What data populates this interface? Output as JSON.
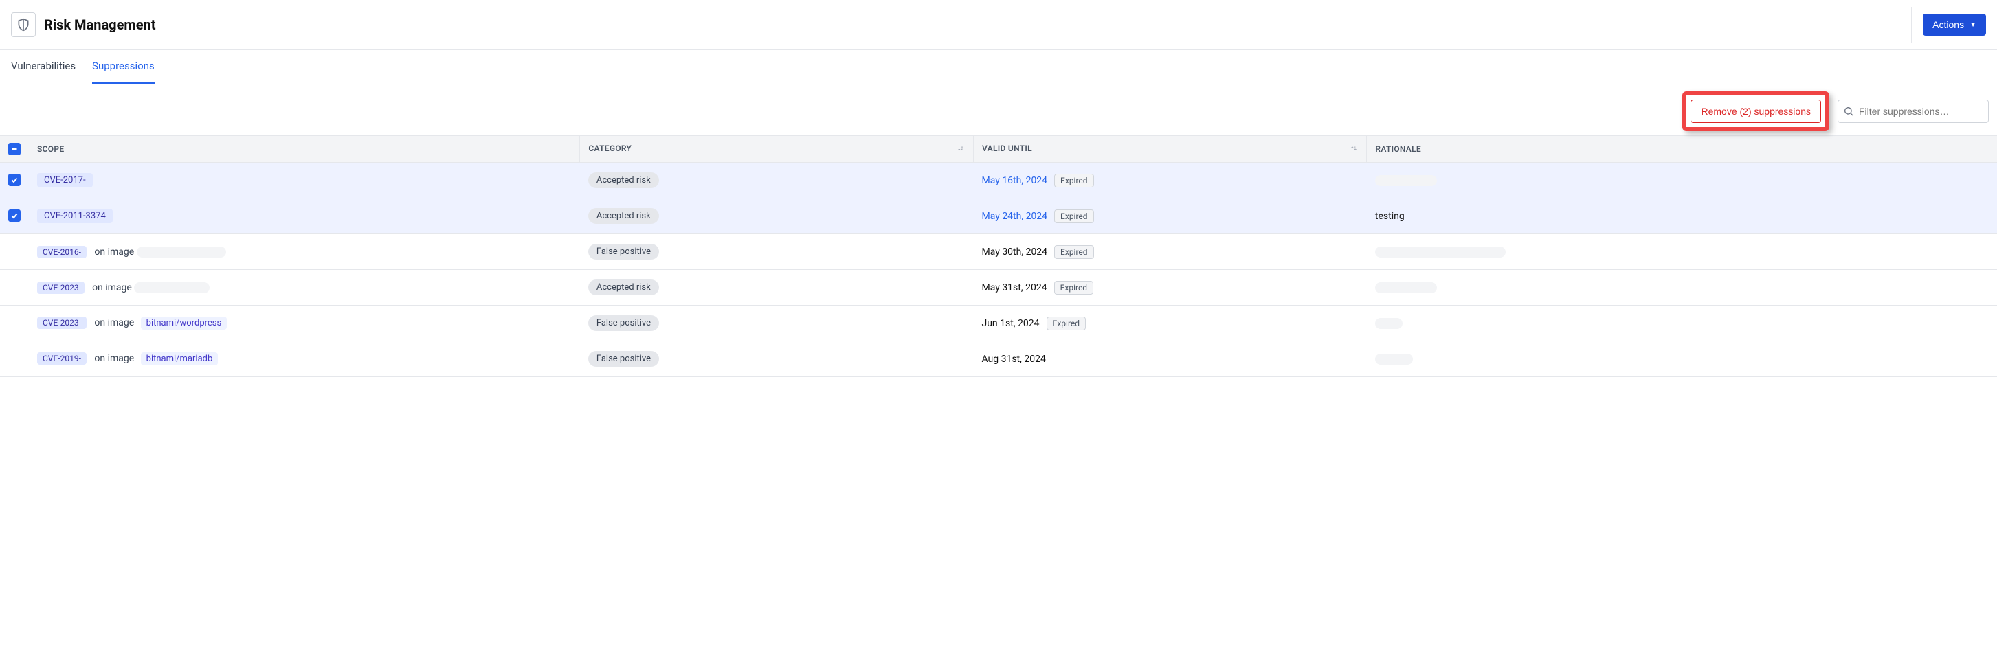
{
  "header": {
    "title": "Risk Management",
    "actions_label": "Actions"
  },
  "tabs": [
    {
      "label": "Vulnerabilities",
      "active": false
    },
    {
      "label": "Suppressions",
      "active": true
    }
  ],
  "toolbar": {
    "remove_label": "Remove (2) suppressions",
    "search_placeholder": "Filter suppressions…"
  },
  "columns": {
    "scope": "SCOPE",
    "category": "CATEGORY",
    "valid_until": "VALID UNTIL",
    "rationale": "RATIONALE"
  },
  "rows": [
    {
      "selected": true,
      "cve": "CVE-2017-",
      "scope_suffix": "",
      "image_chip": "",
      "image_redacted": false,
      "category": "Accepted risk",
      "valid_until": "May 16th, 2024",
      "valid_link": true,
      "expired": "Expired",
      "rationale": "",
      "rationale_redacted": true,
      "rationale_redact_w": 90
    },
    {
      "selected": true,
      "cve": "CVE-2011-3374",
      "scope_suffix": "",
      "image_chip": "",
      "image_redacted": false,
      "category": "Accepted risk",
      "valid_until": "May 24th, 2024",
      "valid_link": true,
      "expired": "Expired",
      "rationale": "testing",
      "rationale_redacted": false,
      "rationale_redact_w": 0
    },
    {
      "selected": false,
      "cve": "CVE-2016-",
      "scope_suffix": "on image",
      "image_chip": "",
      "image_redacted": true,
      "image_redact_w": 130,
      "category": "False positive",
      "valid_until": "May 30th, 2024",
      "valid_link": false,
      "expired": "Expired",
      "rationale": "",
      "rationale_redacted": true,
      "rationale_redact_w": 190
    },
    {
      "selected": false,
      "cve": "CVE-2023",
      "scope_suffix": "on image",
      "image_chip": "",
      "image_redacted": true,
      "image_redact_w": 110,
      "category": "Accepted risk",
      "valid_until": "May 31st, 2024",
      "valid_link": false,
      "expired": "Expired",
      "rationale": "",
      "rationale_redacted": true,
      "rationale_redact_w": 90
    },
    {
      "selected": false,
      "cve": "CVE-2023-",
      "scope_suffix": "on image",
      "image_chip": "bitnami/wordpress",
      "image_redacted": false,
      "category": "False positive",
      "valid_until": "Jun 1st, 2024",
      "valid_link": false,
      "expired": "Expired",
      "rationale": "",
      "rationale_redacted": true,
      "rationale_redact_w": 40
    },
    {
      "selected": false,
      "cve": "CVE-2019-",
      "scope_suffix": "on image",
      "image_chip": "bitnami/mariadb",
      "image_redacted": false,
      "category": "False positive",
      "valid_until": "Aug 31st, 2024",
      "valid_link": false,
      "expired": "",
      "rationale": "",
      "rationale_redacted": true,
      "rationale_redact_w": 55
    }
  ]
}
